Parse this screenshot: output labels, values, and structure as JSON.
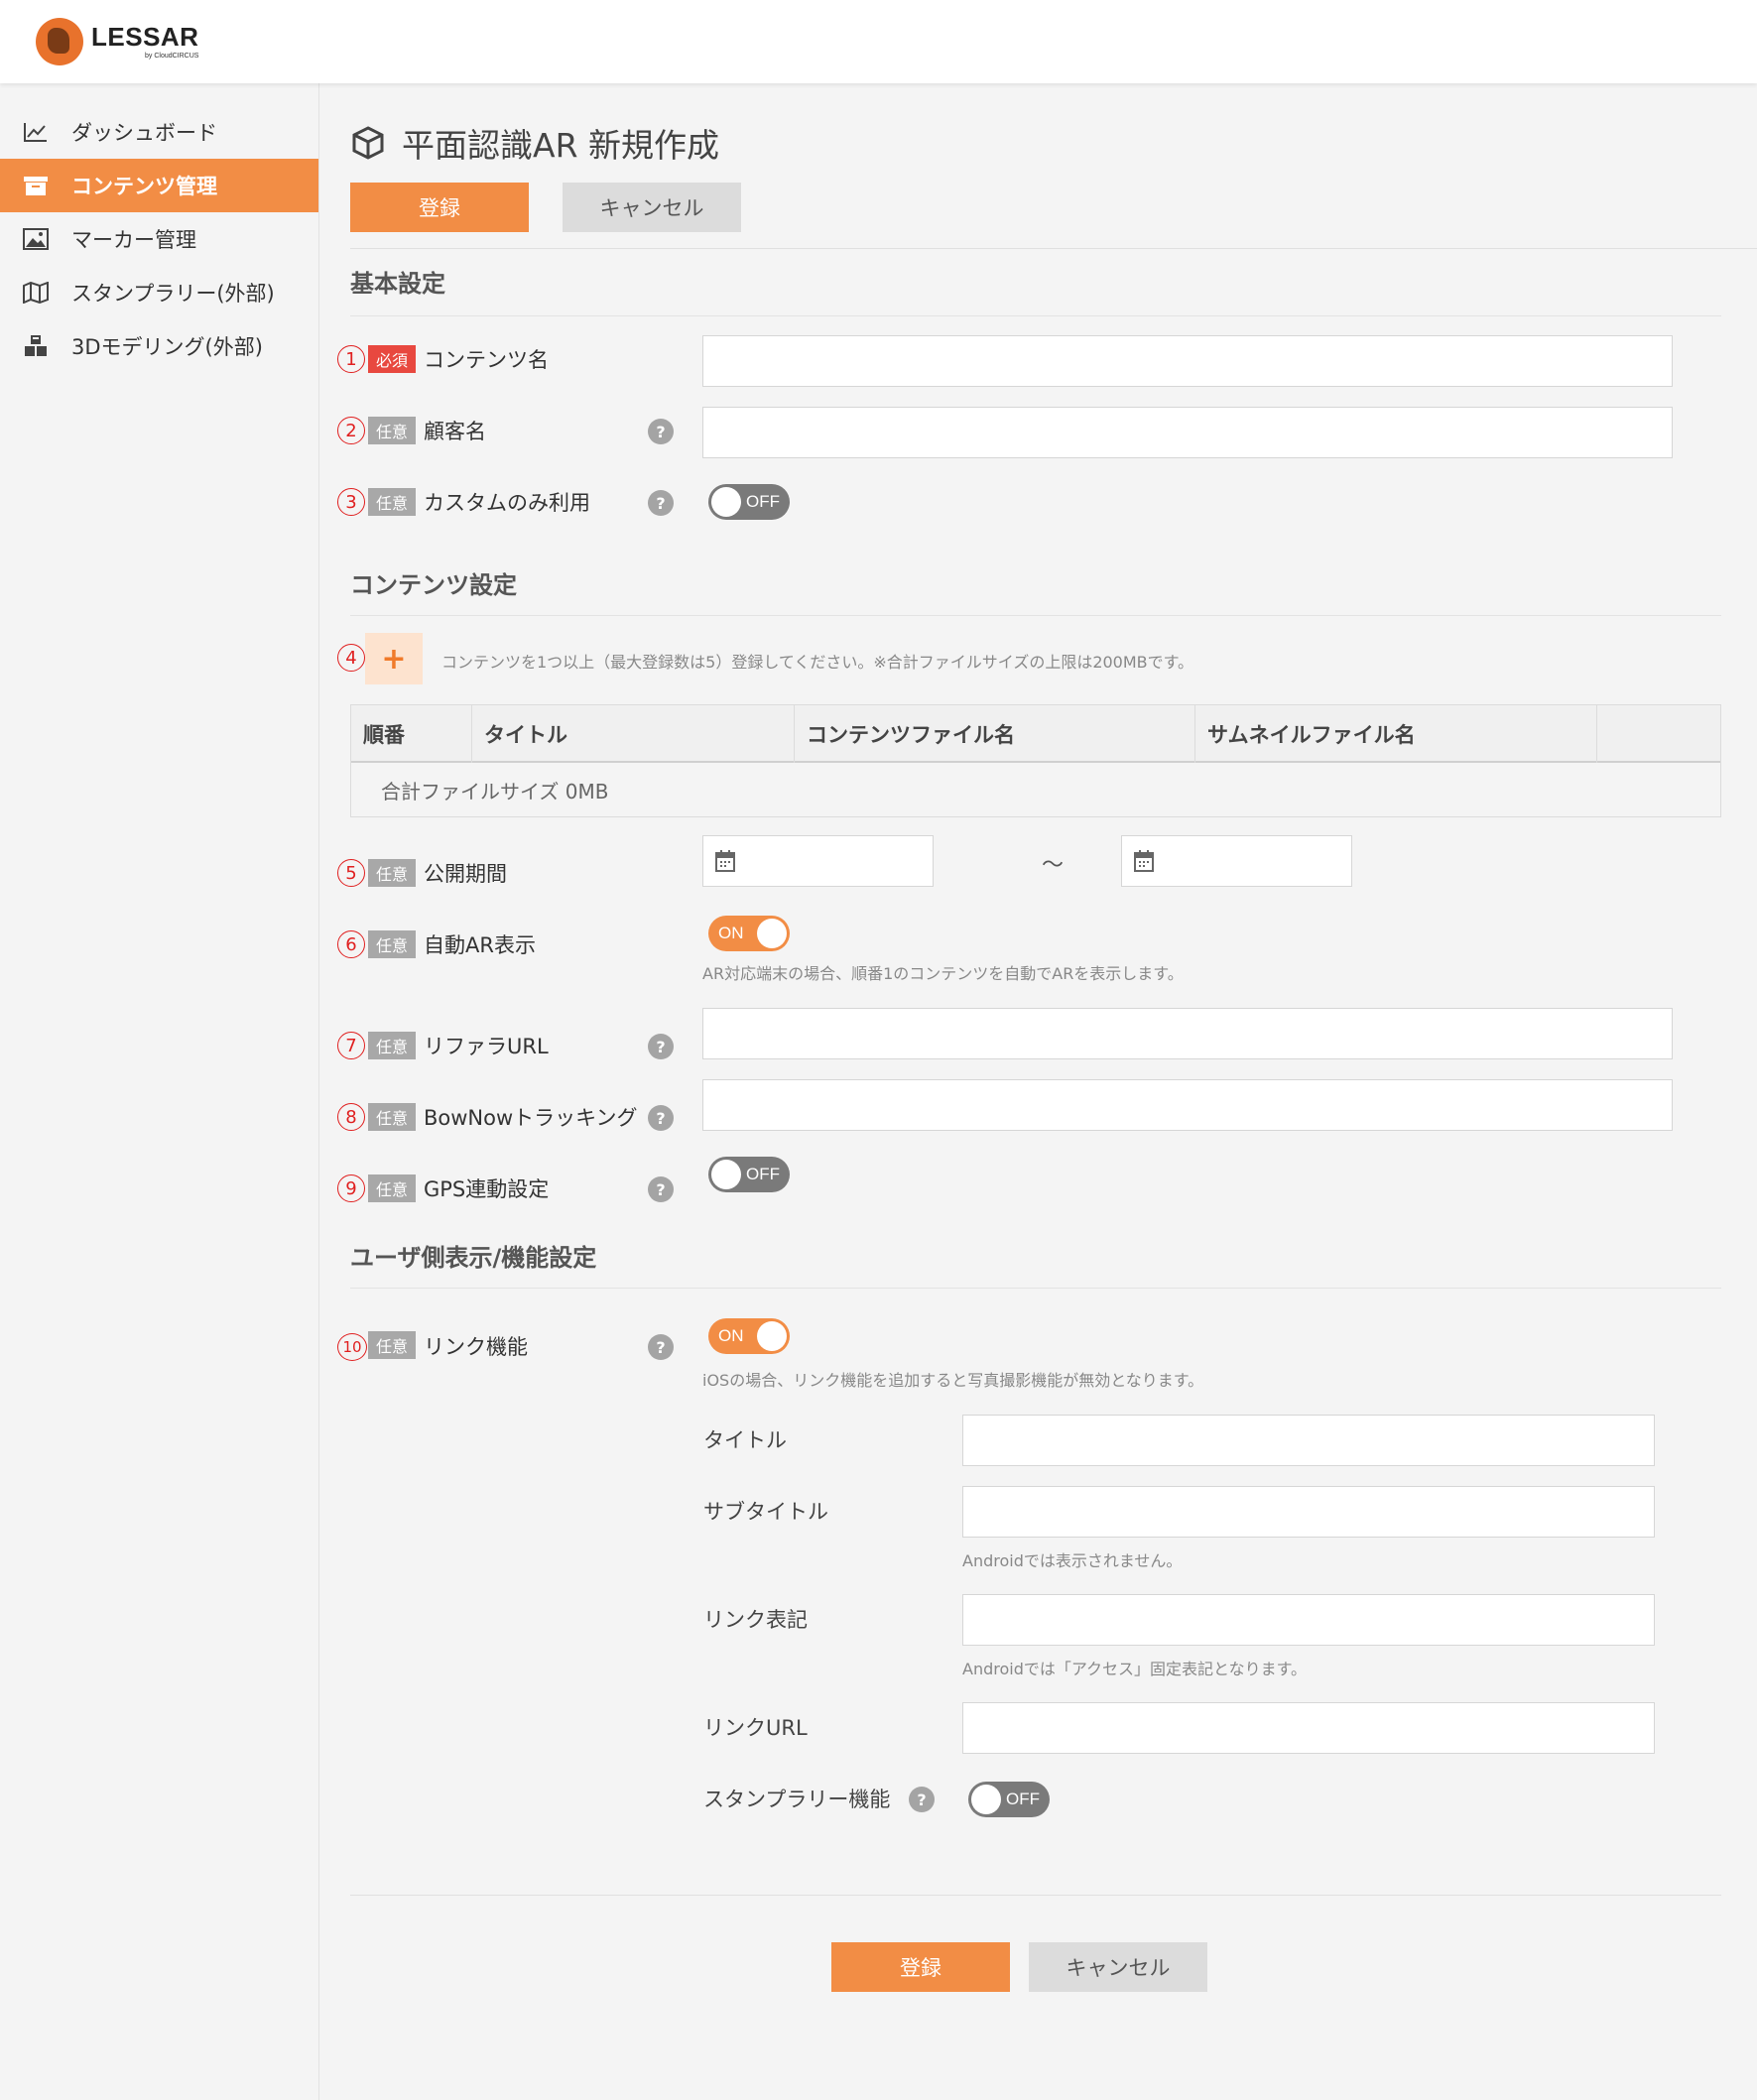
{
  "brand": {
    "name": "LESSAR",
    "sub": "by CloudCIRCUS"
  },
  "sidebar": {
    "items": [
      {
        "label": "ダッシュボード",
        "icon": "chart-line-icon",
        "active": false
      },
      {
        "label": "コンテンツ管理",
        "icon": "archive-box-icon",
        "active": true
      },
      {
        "label": "マーカー管理",
        "icon": "image-icon",
        "active": false
      },
      {
        "label": "スタンプラリー(外部)",
        "icon": "map-icon",
        "active": false
      },
      {
        "label": "3Dモデリング(外部)",
        "icon": "cubes-icon",
        "active": false
      }
    ]
  },
  "page": {
    "title": "平面認識AR 新規作成",
    "title_icon": "cube-icon"
  },
  "buttons": {
    "register": "登録",
    "cancel": "キャンセル"
  },
  "sections": {
    "basic": "基本設定",
    "content": "コンテンツ設定",
    "user": "ユーザ側表示/機能設定"
  },
  "tags": {
    "required": "必須",
    "optional": "任意"
  },
  "fields": {
    "content_name": {
      "num": "1",
      "label": "コンテンツ名",
      "value": ""
    },
    "customer_name": {
      "num": "2",
      "label": "顧客名",
      "value": ""
    },
    "custom_only": {
      "num": "3",
      "label": "カスタムのみ利用",
      "state": "OFF"
    },
    "add_content": {
      "num": "4",
      "hint": "コンテンツを1つ以上（最大登録数は5）登録してください。※合計ファイルサイズの上限は200MBです。"
    },
    "publish_period": {
      "num": "5",
      "label": "公開期間",
      "start": "",
      "end": "",
      "separator": "～"
    },
    "auto_ar": {
      "num": "6",
      "label": "自動AR表示",
      "state": "ON",
      "hint": "AR対応端末の場合、順番1のコンテンツを自動でARを表示します。"
    },
    "referrer_url": {
      "num": "7",
      "label": "リファラURL",
      "value": ""
    },
    "bownow": {
      "num": "8",
      "label": "BowNowトラッキング",
      "value": ""
    },
    "gps": {
      "num": "9",
      "label": "GPS連動設定",
      "state": "OFF"
    },
    "link": {
      "num": "10",
      "label": "リンク機能",
      "state": "ON",
      "hint": "iOSの場合、リンク機能を追加すると写真撮影機能が無効となります。"
    }
  },
  "table": {
    "columns": [
      "順番",
      "タイトル",
      "コンテンツファイル名",
      "サムネイルファイル名",
      ""
    ],
    "footer": "合計ファイルサイズ  0MB"
  },
  "link_settings": {
    "title": {
      "label": "タイトル",
      "value": ""
    },
    "subtitle": {
      "label": "サブタイトル",
      "value": "",
      "hint": "Androidでは表示されません。"
    },
    "link_text": {
      "label": "リンク表記",
      "value": "",
      "hint": "Androidでは「アクセス」固定表記となります。"
    },
    "link_url": {
      "label": "リンクURL",
      "value": ""
    },
    "stamp_rally": {
      "label": "スタンプラリー機能",
      "state": "OFF"
    }
  },
  "help_glyph": "?",
  "add_glyph": "+",
  "colors": {
    "accent": "#f28d45",
    "required": "#e8483f",
    "optional": "#a8a8a8",
    "number_circle": "#e02020"
  }
}
